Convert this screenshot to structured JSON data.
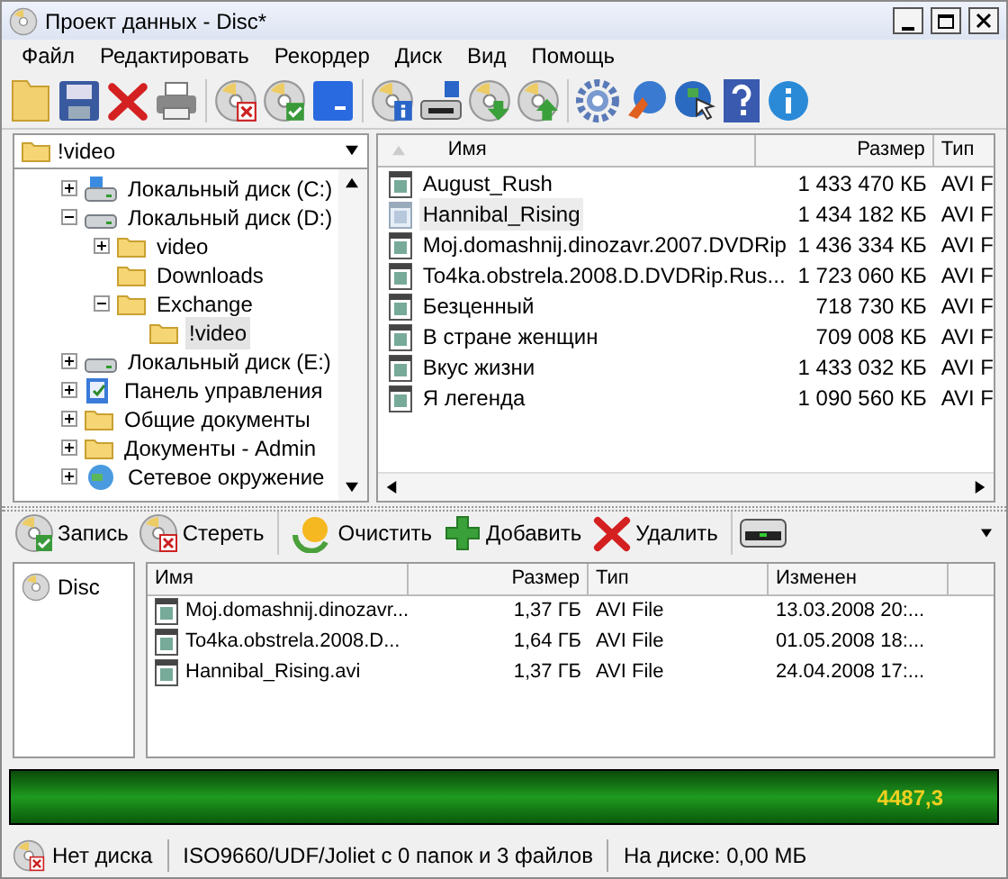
{
  "window": {
    "title": "Проект данных - Disc*"
  },
  "menu": [
    "Файл",
    "Редактировать",
    "Рекордер",
    "Диск",
    "Вид",
    "Помощь"
  ],
  "folder_tree": {
    "address": "!video",
    "items": [
      {
        "label": "Локальный диск (C:)",
        "kind": "system-drive",
        "expanded": false,
        "selected": false
      },
      {
        "label": "Локальный диск (D:)",
        "kind": "drive",
        "expanded": true,
        "selected": false,
        "children": [
          {
            "label": "video",
            "kind": "folder",
            "expanded": false,
            "selected": false
          },
          {
            "label": "Downloads",
            "kind": "folder",
            "selected": false
          },
          {
            "label": "Exchange",
            "kind": "folder",
            "expanded": true,
            "selected": false,
            "children": [
              {
                "label": "!video",
                "kind": "folder",
                "selected": true
              }
            ]
          }
        ]
      },
      {
        "label": "Локальный диск (E:)",
        "kind": "drive",
        "expanded": false,
        "selected": false
      },
      {
        "label": "Панель управления",
        "kind": "control-panel",
        "expanded": false,
        "selected": false
      },
      {
        "label": "Общие документы",
        "kind": "folder",
        "expanded": false,
        "selected": false
      },
      {
        "label": "Документы - Admin",
        "kind": "folder",
        "expanded": false,
        "selected": false
      },
      {
        "label": "Сетевое окружение",
        "kind": "network",
        "expanded": false,
        "selected": false
      }
    ]
  },
  "file_list": {
    "columns": [
      "Имя",
      "Размер",
      "Тип"
    ],
    "rows": [
      {
        "name": "August_Rush",
        "size": "1 433 470 КБ",
        "type": "AVI F",
        "selected": false
      },
      {
        "name": "Hannibal_Rising",
        "size": "1 434 182 КБ",
        "type": "AVI F",
        "selected": true
      },
      {
        "name": "Moj.domashnij.dinozavr.2007.DVDRip",
        "size": "1 436 334 КБ",
        "type": "AVI F",
        "selected": false
      },
      {
        "name": "To4ka.obstrela.2008.D.DVDRip.Rus...",
        "size": "1 723 060 КБ",
        "type": "AVI F",
        "selected": false
      },
      {
        "name": "Безценный",
        "size": "718 730 КБ",
        "type": "AVI F",
        "selected": false
      },
      {
        "name": "В стране женщин",
        "size": "709 008 КБ",
        "type": "AVI F",
        "selected": false
      },
      {
        "name": "Вкус жизни",
        "size": "1 433 032 КБ",
        "type": "AVI F",
        "selected": false
      },
      {
        "name": "Я легенда",
        "size": "1 090 560 КБ",
        "type": "AVI F",
        "selected": false
      }
    ]
  },
  "project_toolbar": [
    {
      "label": "Запись",
      "kind": "burn"
    },
    {
      "label": "Стереть",
      "kind": "erase"
    },
    {
      "label": "Очистить",
      "kind": "clear"
    },
    {
      "label": "Добавить",
      "kind": "add"
    },
    {
      "label": "Удалить",
      "kind": "delete"
    }
  ],
  "project_tree": {
    "items": [
      {
        "label": "Disc",
        "selected": false
      }
    ]
  },
  "project_list": {
    "columns": [
      "Имя",
      "Размер",
      "Тип",
      "Изменен"
    ],
    "rows": [
      {
        "name": "Moj.domashnij.dinozavr...",
        "size": "1,37 ГБ",
        "type": "AVI File",
        "modified": "13.03.2008 20:..."
      },
      {
        "name": "To4ka.obstrela.2008.D...",
        "size": "1,64 ГБ",
        "type": "AVI File",
        "modified": "01.05.2008 18:..."
      },
      {
        "name": "Hannibal_Rising.avi",
        "size": "1,37 ГБ",
        "type": "AVI File",
        "modified": "24.04.2008 17:..."
      }
    ]
  },
  "capacity_bar": {
    "reading": "4487,3"
  },
  "status_bar": {
    "disc": "Нет диска",
    "file_system": "ISO9660/UDF/Joliet с 0 папок и 3 файлов",
    "used": "На диске: 0,00 МБ"
  }
}
